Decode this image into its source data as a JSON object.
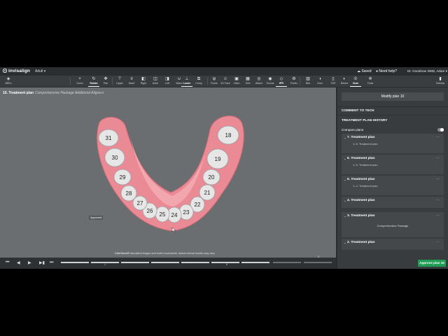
{
  "app": {
    "brand": "invisalign",
    "patient": "Adult",
    "saved_label": "Saved",
    "help_label": "Need help?",
    "user_label": "Dr. Goodman DMD, Adam"
  },
  "toolbar": {
    "items": [
      {
        "label": "BEEs",
        "icon": "home-icon",
        "glyph": "◈"
      },
      {
        "label": "Zoom",
        "icon": "zoom-icon",
        "glyph": "+"
      },
      {
        "label": "Rotate",
        "icon": "rotate-icon",
        "glyph": "↻"
      },
      {
        "label": "Pan",
        "icon": "pan-icon",
        "glyph": "✥"
      },
      {
        "label": "Upper",
        "icon": "upper-icon",
        "glyph": "⊤"
      },
      {
        "label": "Max/l",
        "icon": "maxl-icon",
        "glyph": "≡"
      },
      {
        "label": "Right",
        "icon": "right-icon",
        "glyph": "◧"
      },
      {
        "label": "Anter",
        "icon": "anter-icon",
        "glyph": "◫"
      },
      {
        "label": "Left",
        "icon": "left-icon",
        "glyph": "◨"
      },
      {
        "label": "Mand",
        "icon": "mand-icon",
        "glyph": "∪"
      },
      {
        "label": "Lower",
        "icon": "lower-icon",
        "glyph": "⊥"
      },
      {
        "label": "Comp",
        "icon": "comp-icon",
        "glyph": "⧉"
      },
      {
        "label": "Roots",
        "icon": "roots-icon",
        "glyph": "ψ"
      },
      {
        "label": "3D Face",
        "icon": "face-icon",
        "glyph": "☺"
      },
      {
        "label": "Video",
        "icon": "video-icon",
        "glyph": "▣"
      },
      {
        "label": "Grid",
        "icon": "grid-icon",
        "glyph": "▦"
      },
      {
        "label": "Attach",
        "icon": "attach-icon",
        "glyph": "◎"
      },
      {
        "label": "Occlus",
        "icon": "occlus-icon",
        "glyph": "◉"
      },
      {
        "label": "IPR",
        "icon": "ipr-icon",
        "glyph": "◇"
      },
      {
        "label": "Pontic",
        "icon": "pontic-icon",
        "glyph": "⚙"
      },
      {
        "label": "Bite",
        "icon": "bite-icon",
        "glyph": "▥"
      },
      {
        "label": "Over",
        "icon": "over-icon",
        "glyph": "◑"
      },
      {
        "label": "TMT",
        "icon": "tmt-icon",
        "glyph": "▯"
      },
      {
        "label": "Before",
        "icon": "before-icon",
        "glyph": "◐"
      },
      {
        "label": "Num",
        "icon": "num-icon",
        "glyph": "①"
      },
      {
        "label": "Tools",
        "icon": "tools-icon",
        "glyph": "✲"
      },
      {
        "label": "Sidebar",
        "icon": "sidebar-icon",
        "glyph": "▮"
      }
    ]
  },
  "view": {
    "title": "10. Treatment plan",
    "subtitle": "Comprehensive Package Additional Aligners",
    "clincheck_brand": "ClinCheck®",
    "clincheck_text": "simulated tongue and tooth movements. Actual clinical results may vary."
  },
  "teeth": [
    {
      "num": "18"
    },
    {
      "num": "19"
    },
    {
      "num": "20"
    },
    {
      "num": "21"
    },
    {
      "num": "22"
    },
    {
      "num": "23"
    },
    {
      "num": "24"
    },
    {
      "num": "25"
    },
    {
      "num": "26"
    },
    {
      "num": "27"
    },
    {
      "num": "28"
    },
    {
      "num": "29"
    },
    {
      "num": "30"
    },
    {
      "num": "31"
    }
  ],
  "timeline": {
    "labels": [
      "1",
      "5",
      "8"
    ]
  },
  "panel": {
    "modify_label": "Modify plan 10",
    "comment_header": "COMMENT TO TECH",
    "history_header": "TREATMENT PLAN HISTORY",
    "compare_label": "Compare plans",
    "plans": [
      {
        "title": "7. Treatment plan",
        "sub": "↳ 6. Treatment plan"
      },
      {
        "title": "6. Treatment plan",
        "sub": "↳ 5. Treatment plan"
      },
      {
        "title": "5. Treatment plan",
        "sub": "↳ 4. Treatment plan"
      },
      {
        "title": "4. Treatment plan",
        "sub": ""
      },
      {
        "title": "3. Treatment plan",
        "sub": "",
        "package": "Comprehensive Package"
      },
      {
        "title": "2. Treatment plan",
        "sub": ""
      }
    ],
    "approved_label": "Approved",
    "approve_button": "Approve plan 10"
  },
  "colors": {
    "app_bg": "#6b6e71",
    "panel_bg": "#393c3f",
    "gum": "#e98a95",
    "tooth": "#e6e6e6",
    "approve": "#1f9d55"
  }
}
